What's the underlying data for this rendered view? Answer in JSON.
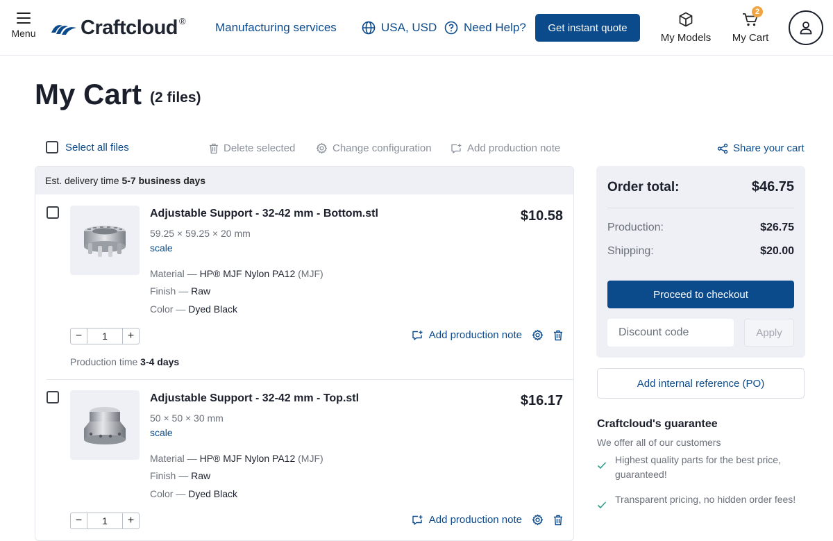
{
  "header": {
    "menu_label": "Menu",
    "logo_text": "Craftcloud",
    "logo_reg": "®",
    "nav_manufacturing": "Manufacturing services",
    "region": "USA, USD",
    "help": "Need Help?",
    "quote_button": "Get instant quote",
    "my_models": "My Models",
    "my_cart": "My Cart",
    "cart_count": "2"
  },
  "page": {
    "title": "My Cart",
    "file_count": "(2 files)"
  },
  "toolbar": {
    "select_all": "Select all files",
    "delete_selected": "Delete selected",
    "change_configuration": "Change configuration",
    "add_production_note": "Add production note",
    "share_cart": "Share your cart"
  },
  "delivery": {
    "prefix": "Est. delivery time ",
    "value": "5-7 business days"
  },
  "items": [
    {
      "name": "Adjustable Support - 32-42 mm - Bottom.stl",
      "dims": "59.25 × 59.25 × 20 mm",
      "scale": "scale",
      "price": "$10.58",
      "material_label": "Material — ",
      "material_value": "HP® MJF Nylon PA12",
      "material_extra": " (MJF)",
      "finish_label": "Finish — ",
      "finish_value": "Raw",
      "color_label": "Color — ",
      "color_value": "Dyed Black",
      "quantity": "1",
      "note": "Add production note",
      "prod_time_label": "Production time ",
      "prod_time_value": "3-4 days"
    },
    {
      "name": "Adjustable Support - 32-42 mm - Top.stl",
      "dims": "50 × 50 × 30 mm",
      "scale": "scale",
      "price": "$16.17",
      "material_label": "Material — ",
      "material_value": "HP® MJF Nylon PA12",
      "material_extra": " (MJF)",
      "finish_label": "Finish — ",
      "finish_value": "Raw",
      "color_label": "Color — ",
      "color_value": "Dyed Black",
      "quantity": "1",
      "note": "Add production note"
    }
  ],
  "summary": {
    "title": "Order total:",
    "total": "$46.75",
    "production_label": "Production:",
    "production_value": "$26.75",
    "shipping_label": "Shipping:",
    "shipping_value": "$20.00",
    "checkout": "Proceed to checkout",
    "discount_placeholder": "Discount code",
    "apply": "Apply",
    "po": "Add internal reference (PO)"
  },
  "guarantee": {
    "title": "Craftcloud's guarantee",
    "subtitle": "We offer all of our customers",
    "points": [
      "Highest quality parts for the best price, guaranteed!",
      "Transparent pricing, no hidden order fees!"
    ]
  },
  "colors": {
    "brand_blue": "#0b4a8b",
    "badge_orange": "#f0a542",
    "panel_gray": "#eef0f5",
    "check_green": "#2e9a8a"
  }
}
